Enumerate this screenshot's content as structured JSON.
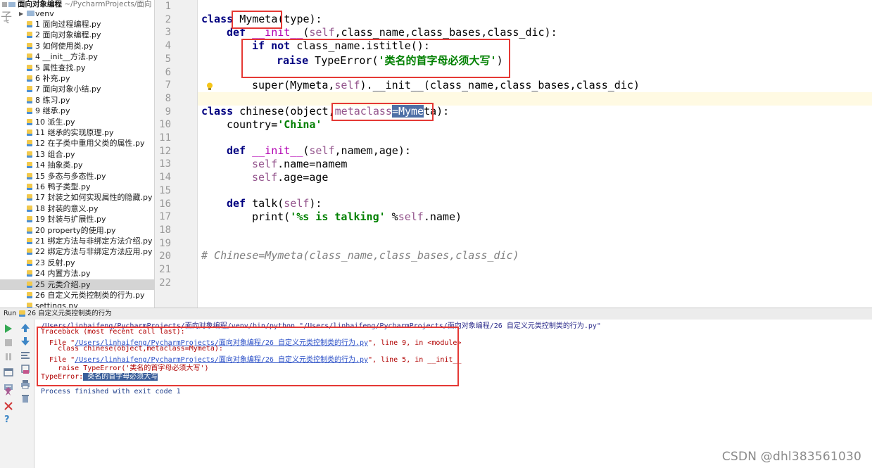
{
  "project": {
    "root_name": "面向对象编程",
    "root_path": "~/PycharmProjects/面向",
    "overlay_glyph": "子",
    "overlay_letter": "c",
    "venv_label": "venv",
    "files": [
      "1 面向过程编程.py",
      "2 面向对象编程.py",
      "3 如何使用类.py",
      "4 __init__方法.py",
      "5 属性查找.py",
      "6 补充.py",
      "7 面向对象小结.py",
      "8 练习.py",
      "9 继承.py",
      "10 派生.py",
      "11 继承的实现原理.py",
      "12 在子类中重用父类的属性.py",
      "13 组合.py",
      "14 抽象类.py",
      "15 多态与多态性.py",
      "16 鸭子类型.py",
      "17 封装之如何实现属性的隐藏.py",
      "18 封装的意义.py",
      "19 封装与扩展性.py",
      "20 property的使用.py",
      "21 绑定方法与非绑定方法介绍.py",
      "22 绑定方法与非绑定方法应用.py",
      "23 反射.py",
      "24 内置方法.py",
      "25 元类介绍.py",
      "26 自定义元类控制类的行为.py",
      "settings.py"
    ],
    "selected_index": 24
  },
  "editor": {
    "line_numbers": [
      "1",
      "2",
      "3",
      "4",
      "5",
      "6",
      "7",
      "8",
      "9",
      "10",
      "11",
      "12",
      "13",
      "14",
      "15",
      "16",
      "17",
      "18",
      "19",
      "20",
      "21",
      "22"
    ],
    "code": {
      "l2_kw": "class",
      "l2_name": "Mymeta",
      "l2_rest": "(type):",
      "l3_kw": "def",
      "l3_name": "__init__",
      "l3_self": "self",
      "l3_rest": ",class_name,class_bases,class_dic):",
      "l4_kw1": "if not",
      "l4_rest": " class_name.istitle():",
      "l5_kw": "raise",
      "l5_fn": " TypeError(",
      "l5_str": "'类名的首字母必须大写'",
      "l5_end": ")",
      "l7_a": "super(Mymeta,",
      "l7_self": "self",
      "l7_b": ").__init__(class_name,class_bases,class_dic)",
      "l9_kw": "class",
      "l9_name": " chinese(object,",
      "l9_meta": "metaclass",
      "l9_sel": "=Myme",
      "l9_end": "ta):",
      "l10_a": "country=",
      "l10_str": "'China'",
      "l12_kw": "def",
      "l12_name": "__init__",
      "l12_self": "self",
      "l12_rest": ",namem,age):",
      "l13_self": "self",
      "l13_rest": ".name=namem",
      "l14_self": "self",
      "l14_rest": ".age=age",
      "l16_kw": "def",
      "l16_name": " talk(",
      "l16_self": "self",
      "l16_end": "):",
      "l17_a": "print(",
      "l17_str": "'%s is talking'",
      "l17_b": " %",
      "l17_self": "self",
      "l17_c": ".name)",
      "l20_cmt": "# Chinese=Mymeta(class_name,class_bases,class_dic)"
    }
  },
  "run": {
    "label": "Run",
    "title": "26 自定义元类控制类的行为",
    "console": {
      "cmd": "/Users/linhaifeng/PycharmProjects/面向对象编程/venv/bin/python \"/Users/linhaifeng/PycharmProjects/面向对象编程/26 自定义元类控制类的行为.py\"",
      "tb_head": "Traceback (most recent call last):",
      "f1_pre": "  File \"",
      "f1_link": "/Users/linhaifeng/PycharmProjects/面向对象编程/26 自定义元类控制类的行为.py",
      "f1_post": "\", line 9, in <module>",
      "f1_code": "    class chinese(object,metaclass=Mymeta):",
      "f2_pre": "  File \"",
      "f2_link": "/Users/linhaifeng/PycharmProjects/面向对象编程/26 自定义元类控制类的行为.py",
      "f2_post": "\", line 5, in __init__",
      "f2_code": "    raise TypeError('类名的首字母必须大写')",
      "err_type": "TypeError:",
      "err_msg": " 类名的首字母必须大写",
      "finish": "Process finished with exit code 1"
    }
  },
  "watermark": "CSDN @dhl383561030",
  "colors": {
    "keyword": "#000080",
    "string": "#008000",
    "self": "#94558d",
    "error": "#b00000",
    "link": "#2a4fc7",
    "highlight_box": "#e53935",
    "run_green": "#34a853"
  }
}
